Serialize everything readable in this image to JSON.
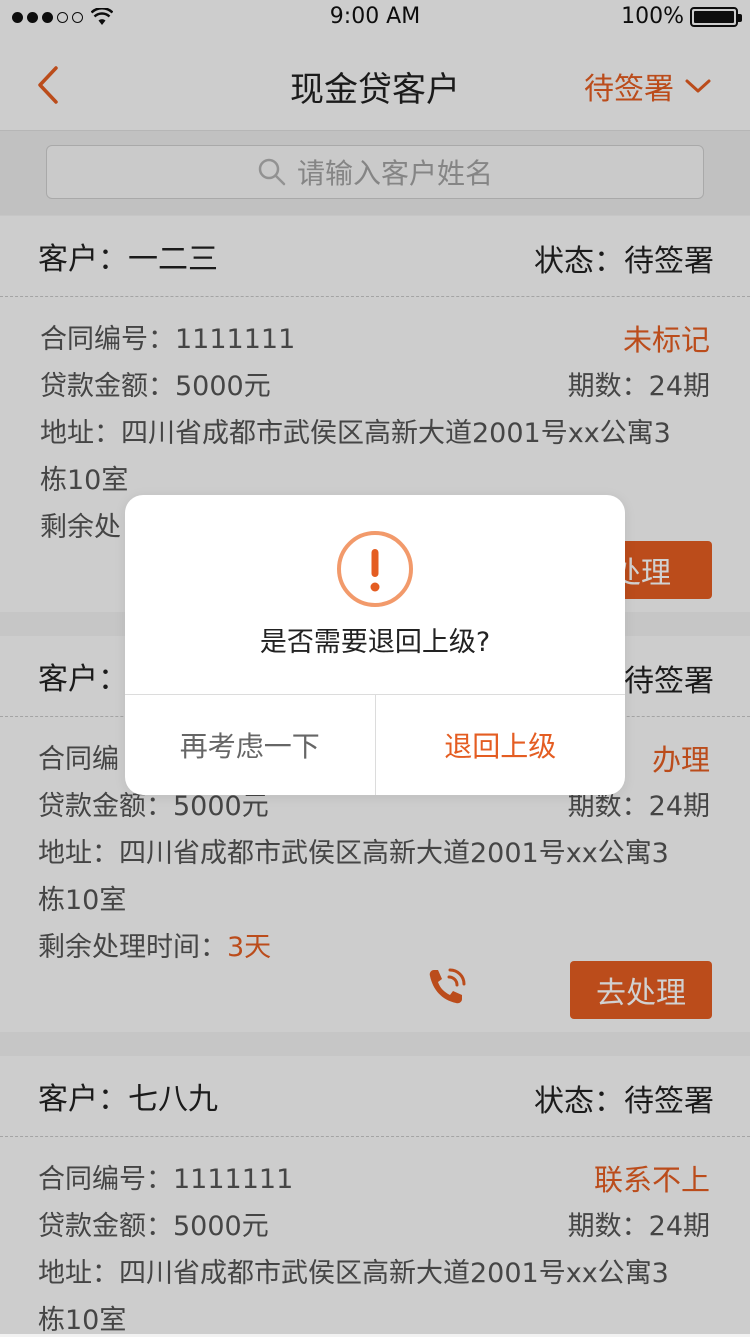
{
  "status_bar": {
    "time": "9:00 AM",
    "battery": "100%"
  },
  "nav": {
    "title": "现金贷客户",
    "filter_label": "待签署"
  },
  "search": {
    "placeholder": "请输入客户姓名"
  },
  "cards": [
    {
      "customer": "客户：一二三",
      "status": "状态：待签署",
      "contract": "合同编号：1111111",
      "flag": "未标记",
      "amount": "贷款金额：5000元",
      "periods": "期数：24期",
      "address_line1": "地址：四川省成都市武侯区高新大道2001号xx公寓3",
      "address_line2": "栋10室",
      "remaining_label": "剩余处",
      "action": "处理"
    },
    {
      "customer": "客户：",
      "status": "待签署",
      "contract": "合同编",
      "flag": "办理",
      "amount": "贷款金额：5000元",
      "periods": "期数：24期",
      "address_line1": "地址：四川省成都市武侯区高新大道2001号xx公寓3",
      "address_line2": "栋10室",
      "remaining_label": "剩余处理时间：",
      "remaining_value": "3天",
      "action": "去处理"
    },
    {
      "customer": "客户：七八九",
      "status": "状态：待签署",
      "contract": "合同编号：1111111",
      "flag": "联系不上",
      "amount": "贷款金额：5000元",
      "periods": "期数：24期",
      "address_line1": "地址：四川省成都市武侯区高新大道2001号xx公寓3",
      "address_line2": "栋10室"
    }
  ],
  "dialog": {
    "message": "是否需要退回上级?",
    "cancel": "再考虑一下",
    "confirm": "退回上级"
  },
  "colors": {
    "accent": "#e45d22"
  }
}
